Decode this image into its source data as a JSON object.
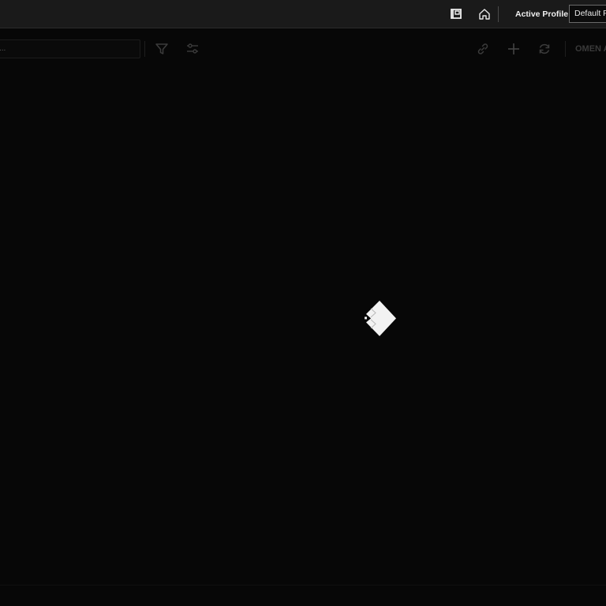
{
  "title_bar": {
    "active_profile_label": "Active Profile",
    "profile_select_value": "Default P",
    "icons": [
      "library-icon",
      "home-icon"
    ]
  },
  "toolbar": {
    "search_value": "...",
    "icons": [
      "filter-icon",
      "sliders-icon",
      "link-icon",
      "plus-icon",
      "refresh-icon"
    ],
    "omen_label": "OMEN A"
  },
  "main": {
    "loading_icon": "omen-diamond-loader-icon"
  },
  "colors": {
    "background": "#070707",
    "title_bar": "#1a1a1a",
    "text": "#f0f0f0",
    "muted_icon": "#3c3c3c",
    "loader": "#f2f2f2"
  }
}
